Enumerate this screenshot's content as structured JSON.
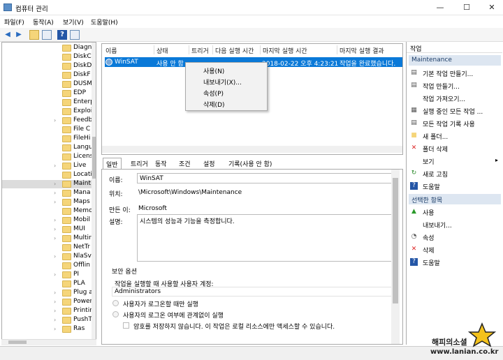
{
  "window": {
    "title": "컴퓨터 관리"
  },
  "menu": [
    "파일(F)",
    "동작(A)",
    "보기(V)",
    "도움말(H)"
  ],
  "tree": {
    "items": [
      "Diagn",
      "DiskC",
      "DiskD",
      "DiskF",
      "DUSM",
      "EDP",
      "Enterp",
      "Exploi",
      "Feedb",
      "File C",
      "FileHi",
      "Langu",
      "Licens",
      "Live",
      "Locati",
      "Maint",
      "Mana",
      "Maps",
      "Memo",
      "Mobil",
      "MUI",
      "Multir",
      "NetTr",
      "NlaSv",
      "Offlin",
      "PI",
      "PLA",
      "Plug a",
      "Power",
      "Printir",
      "PushT",
      "Ras"
    ],
    "selected": "Maint"
  },
  "columns": [
    "이름",
    "상태",
    "트리거",
    "다음 실행 시간",
    "마지막 실행 시간",
    "마지막 실행 결과"
  ],
  "task": {
    "name": "WinSAT",
    "status": "사용 안 함",
    "last_run": "2018-02-22 오후 4:23:21",
    "last_result": "작업을 완료했습니다."
  },
  "context_menu": [
    "사용(N)",
    "내보내기(X)...",
    "속성(P)",
    "삭제(D)"
  ],
  "tabs": [
    "일반",
    "트리거",
    "동작",
    "조건",
    "설정",
    "기록(사용 안 함)"
  ],
  "detail": {
    "name_label": "이름:",
    "name_value": "WinSAT",
    "location_label": "위치:",
    "location_value": "\\Microsoft\\Windows\\Maintenance",
    "author_label": "만든 이:",
    "author_value": "Microsoft",
    "desc_label": "설명:",
    "desc_value": "시스템의 성능과 기능을 측정합니다.",
    "security_title": "보안 옵션",
    "account_label": "작업을 실행할 때 사용할 사용자 계정:",
    "account_value": "Administrators",
    "opt1": "사용자가 로그온할 때만 실행",
    "opt2": "사용자의 로그온 여부에 관계없이 실행",
    "opt3": "암호를 저장하지 않습니다. 이 작업은 로컬 리소스에만 액세스할 수 있습니다."
  },
  "actions": {
    "header": "작업",
    "section1": "Maintenance",
    "items1": [
      "기본 작업 만들기...",
      "작업 만들기...",
      "작업 가져오기...",
      "실행 중인 모든 작업 ...",
      "모든 작업 기록 사용",
      "새 폴더...",
      "폴더 삭제",
      "보기",
      "새로 고침",
      "도움말"
    ],
    "section2": "선택한 항목",
    "items2": [
      "사용",
      "내보내기...",
      "속성",
      "삭제",
      "도움말"
    ]
  },
  "watermark": {
    "line1": "해피의소셜",
    "line2": "www.lanian.co.kr"
  },
  "colors": {
    "selection": "#0a79d8",
    "section_bg": "#dde6f1",
    "folder": "#f5d57a"
  }
}
